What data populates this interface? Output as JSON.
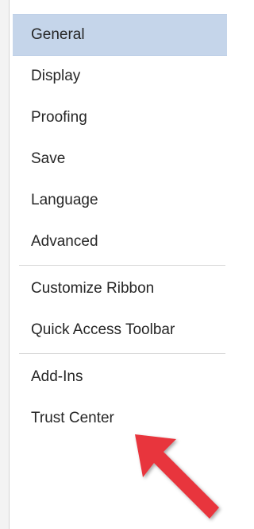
{
  "options_nav": {
    "group1": [
      {
        "label": "General",
        "selected": true
      },
      {
        "label": "Display",
        "selected": false
      },
      {
        "label": "Proofing",
        "selected": false
      },
      {
        "label": "Save",
        "selected": false
      },
      {
        "label": "Language",
        "selected": false
      },
      {
        "label": "Advanced",
        "selected": false
      }
    ],
    "group2": [
      {
        "label": "Customize Ribbon",
        "selected": false
      },
      {
        "label": "Quick Access Toolbar",
        "selected": false
      }
    ],
    "group3": [
      {
        "label": "Add-Ins",
        "selected": false
      },
      {
        "label": "Trust Center",
        "selected": false
      }
    ]
  },
  "colors": {
    "selected_background": "#c5d5ea",
    "annotation_arrow": "#e8343c"
  }
}
